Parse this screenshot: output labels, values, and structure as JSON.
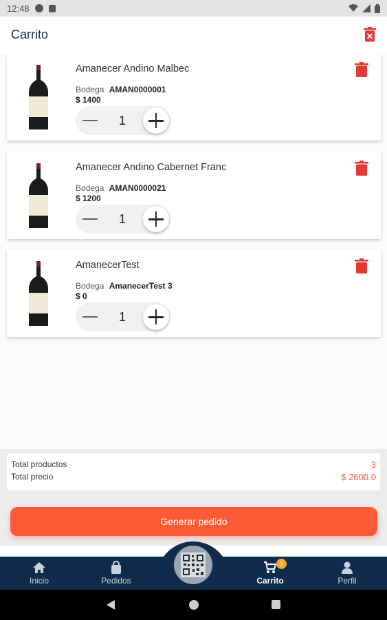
{
  "status_bar": {
    "time": "12:48"
  },
  "appbar": {
    "title": "Carrito"
  },
  "items": [
    {
      "name": "Amanecer Andino Malbec",
      "bodega_label": "Bodega",
      "bodega_value": "AMAN0000001",
      "price": "$ 1400",
      "quantity": "1"
    },
    {
      "name": "Amanecer Andino Cabernet Franc",
      "bodega_label": "Bodega",
      "bodega_value": "AMAN0000021",
      "price": "$ 1200",
      "quantity": "1"
    },
    {
      "name": "AmanecerTest",
      "bodega_label": "Bodega",
      "bodega_value": "AmanecerTest 3",
      "price": "$ 0",
      "quantity": "1"
    }
  ],
  "summary": {
    "total_products_label": "Total productos",
    "total_products_value": "3",
    "total_price_label": "Total precio",
    "total_price_value": "$ 2600.0"
  },
  "cta": {
    "label": "Generar pedido"
  },
  "nav": {
    "items": [
      {
        "label": "Inicio",
        "icon": "home-icon"
      },
      {
        "label": "Pedidos",
        "icon": "bag-icon"
      },
      {
        "label": "Carrito",
        "icon": "cart-icon",
        "active": true
      },
      {
        "label": "Perfil",
        "icon": "person-icon"
      }
    ],
    "cart_badge": "3",
    "fab_icon": "qr-code-icon"
  },
  "colors": {
    "accent": "#ff5a36",
    "navy": "#0f2d4b",
    "delete": "#e53935",
    "badge": "#f5a623"
  }
}
